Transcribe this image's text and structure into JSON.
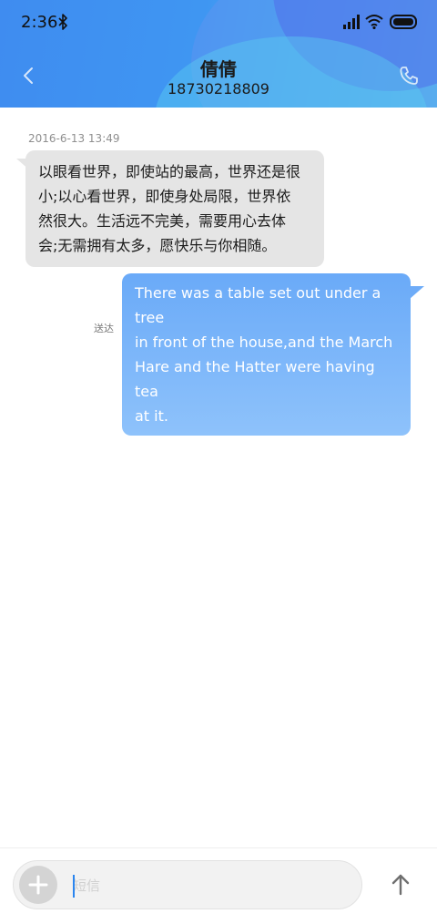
{
  "status_bar": {
    "time": "2:36",
    "icons": [
      "bluetooth-icon",
      "signal-icon",
      "wifi-icon",
      "battery-icon"
    ]
  },
  "header": {
    "contact_name": "倩倩",
    "contact_number": "18730218809",
    "back_icon": "chevron-left-icon",
    "call_icon": "phone-icon"
  },
  "conversation": {
    "timestamp": "2016-6-13 13:49",
    "incoming": {
      "lines": [
        "以眼看世界，即使站的最高，世界还是很",
        "小;以心看世界，即使身处局限，世界依",
        "然很大。生活远不完美，需要用心去体",
        "会;无需拥有太多，愿快乐与你相随。"
      ]
    },
    "outgoing": {
      "lines": [
        "There was a table set out under a tree",
        "in front of the house,and the March",
        "Hare and the Hatter were having tea",
        "at it."
      ],
      "status": "送达"
    }
  },
  "composer": {
    "placeholder": "短信",
    "value": "",
    "add_icon": "plus-icon",
    "send_icon": "arrow-up-icon"
  },
  "colors": {
    "header_gradient_start": "#3f8cf0",
    "header_gradient_end": "#54c8ea",
    "incoming_bubble": "#e5e5e5",
    "outgoing_bubble": "#7db6fa",
    "caret": "#2a85ef"
  }
}
